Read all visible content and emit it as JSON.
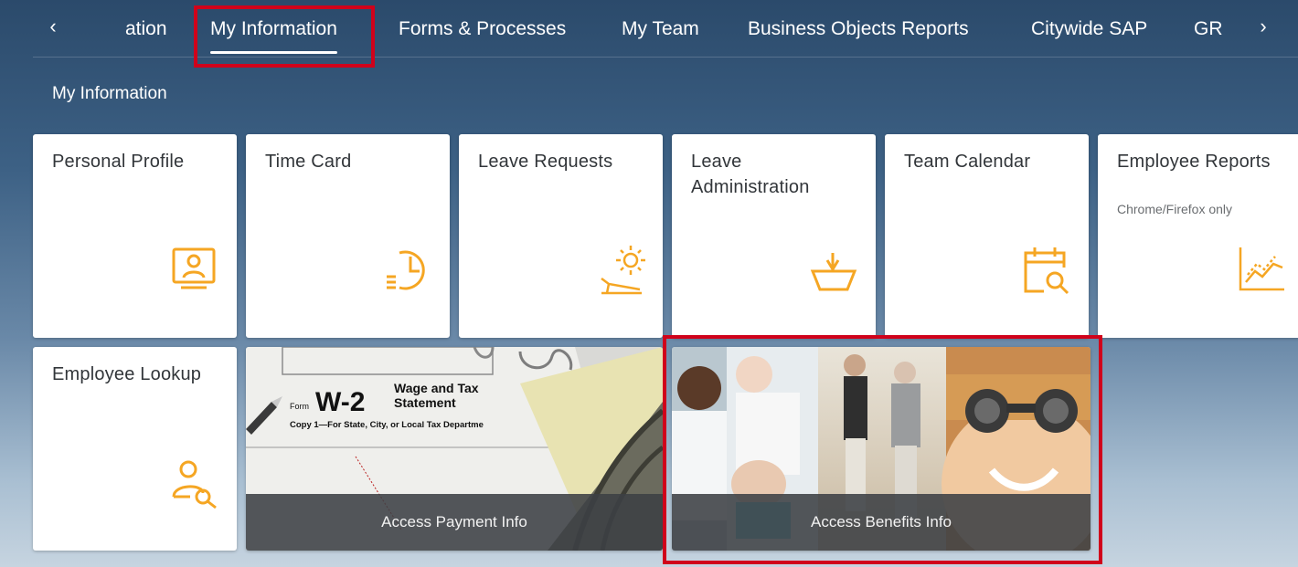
{
  "nav": {
    "prev_arrow": "‹",
    "next_arrow": "›",
    "tabs": [
      {
        "label": "ation"
      },
      {
        "label": "My Information"
      },
      {
        "label": "Forms & Processes"
      },
      {
        "label": "My Team"
      },
      {
        "label": "Business Objects Reports"
      },
      {
        "label": "Citywide SAP"
      },
      {
        "label": "GR"
      }
    ]
  },
  "section": {
    "title": "My Information"
  },
  "tiles": [
    {
      "title": "Personal Profile",
      "icon": "personal-profile-icon"
    },
    {
      "title": "Time Card",
      "icon": "time-card-icon"
    },
    {
      "title": "Leave Requests",
      "icon": "leave-requests-icon"
    },
    {
      "title": "Leave Administration",
      "icon": "leave-administration-icon"
    },
    {
      "title": "Team Calendar",
      "icon": "team-calendar-icon"
    },
    {
      "title": "Employee Reports",
      "subtitle": "Chrome/Firefox only",
      "icon": "employee-reports-icon"
    },
    {
      "title": "Employee Lookup",
      "icon": "employee-lookup-icon"
    }
  ],
  "image_tiles": [
    {
      "caption": "Access Payment Info",
      "form": {
        "form_label": "Form",
        "form_number": "W-2",
        "form_title_1": "Wage and Tax",
        "form_title_2": "Statement",
        "copy_line": "Copy 1—For State, City, or Local Tax Departme"
      }
    },
    {
      "caption": "Access Benefits Info"
    }
  ],
  "colors": {
    "accent_icon": "#f5a623",
    "highlight": "#d0021b",
    "tile_bg": "#ffffff",
    "caption_bg": "#3c4044"
  }
}
